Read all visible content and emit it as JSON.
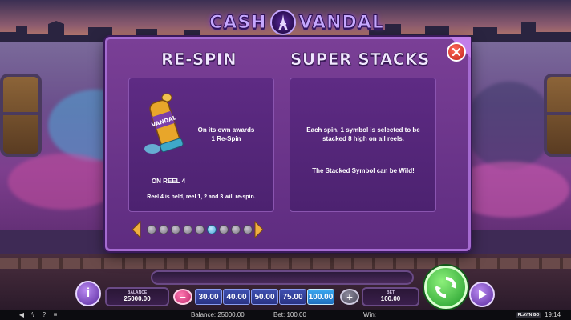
{
  "logo": {
    "left_word": "CASH",
    "right_word": "VANDAL"
  },
  "panel": {
    "respin": {
      "title": "RE-SPIN",
      "awards_text": "On its own awards\n1 Re-Spin",
      "reel_label": "ON REEL 4",
      "reel_note": "Reel 4 is held, reel 1, 2 and 3 will re-spin.",
      "symbol_text": "VANDAL"
    },
    "super_stacks": {
      "title": "SUPER STACKS",
      "line1": "Each spin, 1 symbol is selected to be\nstacked 8 high on all reels.",
      "line2": "The Stacked Symbol can be Wild!"
    },
    "pager": {
      "page_count": 9,
      "active_page": 6
    }
  },
  "console": {
    "info_label": "i",
    "balance_label": "BALANCE",
    "balance_value": "25000.00",
    "bet_label": "BET",
    "bet_value": "100.00",
    "minus_label": "−",
    "plus_label": "+",
    "stakes": [
      "30.00",
      "40.00",
      "50.00",
      "75.00",
      "100.00"
    ],
    "selected_stake": "100.00"
  },
  "statusbar": {
    "balance_text": "Balance: 25000.00",
    "bet_text": "Bet: 100.00",
    "win_text": "Win:",
    "brand": "PLAY'N GO",
    "time": "19:14"
  },
  "colors": {
    "panel": "#6b3590",
    "accent": "#a56bd1",
    "spin": "#2fb83a",
    "close": "#e0392c",
    "selected_stake": "#2f8fe0"
  },
  "icons": [
    "close-icon",
    "arrow-left-icon",
    "arrow-right-icon",
    "spin-icon",
    "play-icon",
    "speaker-icon",
    "lightning-icon",
    "question-icon",
    "menu-icon"
  ]
}
